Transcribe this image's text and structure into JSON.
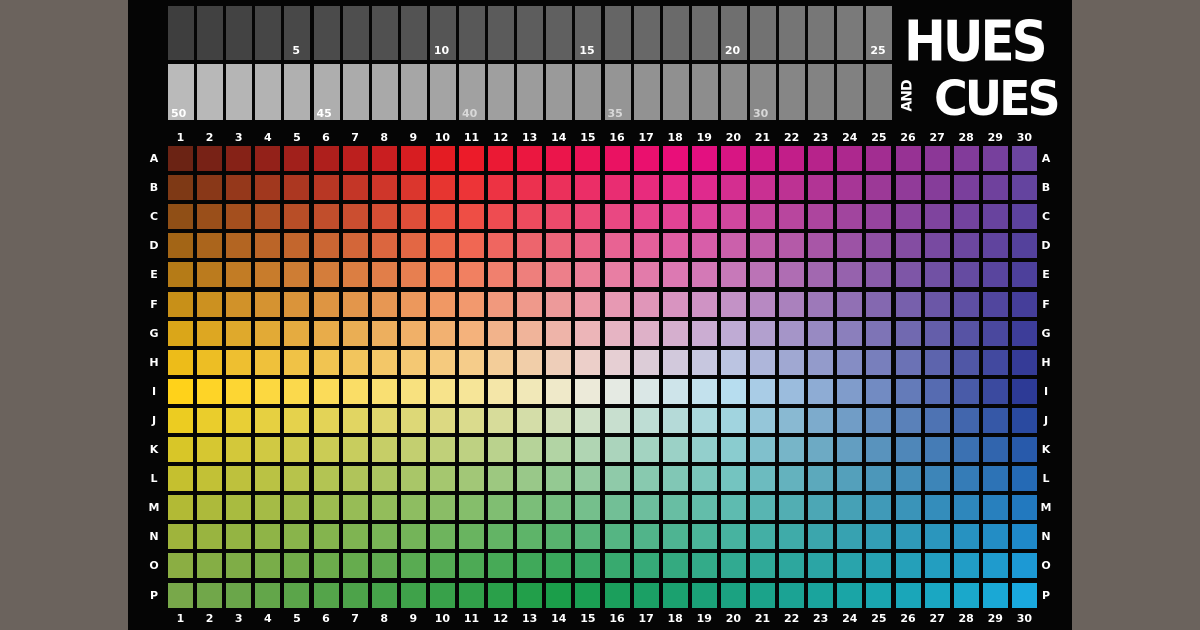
{
  "game": {
    "logo": {
      "line1": "HUES",
      "and": "AND",
      "line2": "CUES"
    },
    "score_track": {
      "top_row_numbers": [
        "5",
        "10",
        "15",
        "20",
        "25"
      ],
      "bottom_row_numbers": [
        "50",
        "45",
        "40",
        "35",
        "30"
      ]
    },
    "columns": [
      "1",
      "2",
      "3",
      "4",
      "5",
      "6",
      "7",
      "8",
      "9",
      "10",
      "11",
      "12",
      "13",
      "14",
      "15",
      "16",
      "17",
      "18",
      "19",
      "20",
      "21",
      "22",
      "23",
      "24",
      "25",
      "26",
      "27",
      "28",
      "29",
      "30"
    ],
    "rows": [
      "A",
      "B",
      "C",
      "D",
      "E",
      "F",
      "G",
      "H",
      "I",
      "J",
      "K",
      "L",
      "M",
      "N",
      "O",
      "P"
    ],
    "corner_colors": {
      "top_left": "#6b2314",
      "top_mid": "#ec1c24",
      "top_mid2": "#e90d7e",
      "top_right": "#6c45a0",
      "mid_left": "#ffd21a",
      "mid_right": "#2d3a96",
      "bottom_left": "#78a84a",
      "bottom_mid": "#1b9e4a",
      "bottom_right": "#1aa9de"
    }
  }
}
